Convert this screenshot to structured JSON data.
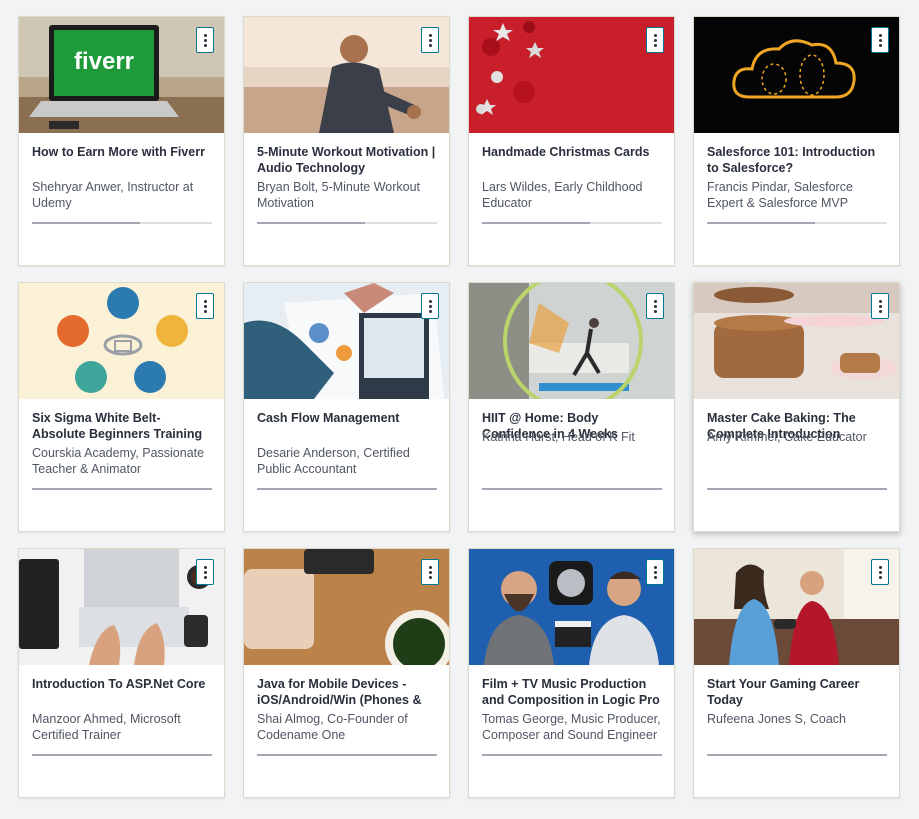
{
  "courses": [
    {
      "title": "How to Earn More with Fiverr",
      "author": "Shehryar Anwer, Instructor at Udemy",
      "thumbnail": "fiverr-laptop",
      "progress": 0.6
    },
    {
      "title": "5-Minute Workout Motivation | Audio Technology",
      "author": "Bryan Bolt, 5-Minute Workout Motivation",
      "thumbnail": "runner-woman",
      "progress": 0.6
    },
    {
      "title": "Handmade Christmas Cards",
      "author": "Lars Wildes, Early Childhood Educator",
      "thumbnail": "christmas-ornaments",
      "progress": 0.6
    },
    {
      "title": "Salesforce 101: Introduction to Salesforce?",
      "author": "Francis Pindar, Salesforce Expert & Salesforce MVP",
      "thumbnail": "cloud-logo",
      "progress": 0.6
    },
    {
      "title": "Six Sigma White Belt- Absolute Beginners Training",
      "author": "Courskia Academy, Passionate Teacher & Animator",
      "thumbnail": "six-sigma-circles",
      "progress": 1.0
    },
    {
      "title": "Cash Flow Management",
      "author": "Desarie Anderson, Certified Public Accountant",
      "thumbnail": "business-charts",
      "progress": 1.0
    },
    {
      "title": "HIIT @ Home: Body Confidence in 4 Weeks",
      "author": "Katrina Hurst, Head of K Fit",
      "thumbnail": "home-workout",
      "progress": 1.0
    },
    {
      "title": "Master Cake Baking: The Complete Introduction",
      "author": "Amy Kimmel, Cake Educator",
      "thumbnail": "cake-stands",
      "progress": 1.0
    },
    {
      "title": "Introduction To ASP.Net Core",
      "author": "Manzoor Ahmed, Microsoft Certified Trainer",
      "thumbnail": "laptop-desk",
      "progress": 1.0
    },
    {
      "title": "Java for Mobile Devices - iOS/Android/Win (Phones &",
      "author": "Shai Almog, Co-Founder of Codename One",
      "thumbnail": "wood-desk-coffee",
      "progress": 1.0
    },
    {
      "title": "Film + TV Music Production and Composition in Logic Pro",
      "author": "Tomas George, Music Producer, Composer and Sound Engineer",
      "thumbnail": "music-producers",
      "progress": 1.0
    },
    {
      "title": "Start Your Gaming Career Today",
      "author": "Rufeena Jones S, Coach",
      "thumbnail": "gamers-couch",
      "progress": 1.0
    }
  ],
  "colors": {
    "accent": "#007791",
    "title": "#29303b",
    "muted": "#505763"
  }
}
